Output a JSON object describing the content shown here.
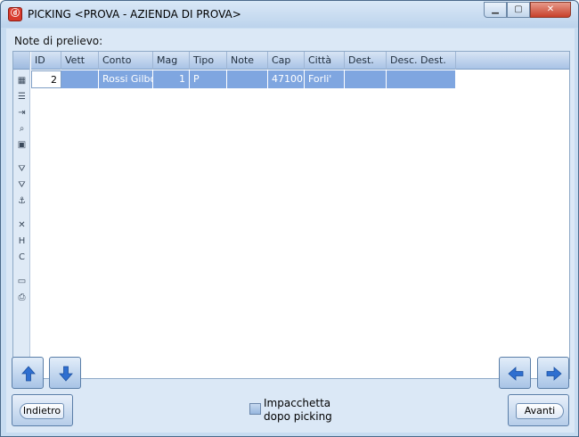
{
  "window": {
    "title": "PICKING <PROVA - AZIENDA DI PROVA>",
    "icon": "app-icon",
    "controls": {
      "minimize": "▁",
      "maximize": "▢",
      "close": "✕"
    }
  },
  "notes_label": "Note di prelievo:",
  "grid": {
    "columns": [
      "ID",
      "Vett",
      "Conto",
      "Mag",
      "Tipo",
      "Note",
      "Cap",
      "Città",
      "Dest.",
      "Desc. Dest."
    ],
    "rows": [
      {
        "id": "2",
        "vett": "",
        "conto": "Rossi Gilbo",
        "mag": "1",
        "tipo": "P",
        "note": "",
        "cap": "47100",
        "citta": "Forli'",
        "dest": "",
        "desc_dest": ""
      }
    ],
    "selected_row_color": "#7fa6e0"
  },
  "side_toolbar": {
    "icons": [
      "layout-icon",
      "list-icon",
      "export-icon",
      "search-icon",
      "grid-icon",
      "filter-icon",
      "filter-clear-icon",
      "anchor-icon",
      "clear-x-icon",
      "column-h-icon",
      "column-c-icon",
      "monitor-icon",
      "print-icon"
    ],
    "glyphs": [
      "▦",
      "☰",
      "⇥",
      "⌕",
      "▣",
      "⛛",
      "⛛",
      "⚓",
      "✕",
      "H",
      "C",
      "▭",
      "⎙"
    ]
  },
  "buttons": {
    "back_label": "Indietro",
    "next_label": "Avanti"
  },
  "checkbox": {
    "label_line1": "Impacchetta",
    "label_line2": "dopo picking",
    "checked": false
  }
}
